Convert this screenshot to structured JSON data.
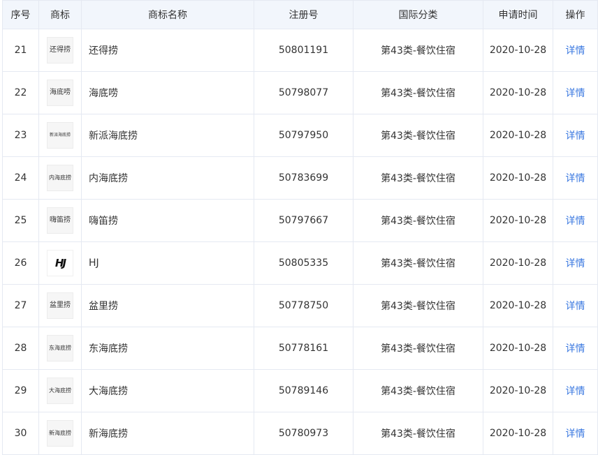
{
  "headers": {
    "index": "序号",
    "logo": "商标",
    "name": "商标名称",
    "reg_no": "注册号",
    "class": "国际分类",
    "date": "申请时间",
    "action": "操作"
  },
  "rows": [
    {
      "index": "21",
      "logo_text": "还得捞",
      "name": "还得捞",
      "reg_no": "50801191",
      "class": "第43类-餐饮住宿",
      "date": "2020-10-28",
      "action": "详情"
    },
    {
      "index": "22",
      "logo_text": "海底唠",
      "name": "海底唠",
      "reg_no": "50798077",
      "class": "第43类-餐饮住宿",
      "date": "2020-10-28",
      "action": "详情"
    },
    {
      "index": "23",
      "logo_text": "新派海底捞",
      "name": "新派海底捞",
      "reg_no": "50797950",
      "class": "第43类-餐饮住宿",
      "date": "2020-10-28",
      "action": "详情"
    },
    {
      "index": "24",
      "logo_text": "内海底捞",
      "name": "内海底捞",
      "reg_no": "50783699",
      "class": "第43类-餐饮住宿",
      "date": "2020-10-28",
      "action": "详情"
    },
    {
      "index": "25",
      "logo_text": "嗨笛捞",
      "name": "嗨笛捞",
      "reg_no": "50797667",
      "class": "第43类-餐饮住宿",
      "date": "2020-10-28",
      "action": "详情"
    },
    {
      "index": "26",
      "logo_text": "HJ",
      "name": "HJ",
      "reg_no": "50805335",
      "class": "第43类-餐饮住宿",
      "date": "2020-10-28",
      "action": "详情"
    },
    {
      "index": "27",
      "logo_text": "盆里捞",
      "name": "盆里捞",
      "reg_no": "50778750",
      "class": "第43类-餐饮住宿",
      "date": "2020-10-28",
      "action": "详情"
    },
    {
      "index": "28",
      "logo_text": "东海底捞",
      "name": "东海底捞",
      "reg_no": "50778161",
      "class": "第43类-餐饮住宿",
      "date": "2020-10-28",
      "action": "详情"
    },
    {
      "index": "29",
      "logo_text": "大海底捞",
      "name": "大海底捞",
      "reg_no": "50789146",
      "class": "第43类-餐饮住宿",
      "date": "2020-10-28",
      "action": "详情"
    },
    {
      "index": "30",
      "logo_text": "新海底捞",
      "name": "新海底捞",
      "reg_no": "50780973",
      "class": "第43类-餐饮住宿",
      "date": "2020-10-28",
      "action": "详情"
    }
  ],
  "colors": {
    "header_background": "#f2f6fc",
    "border": "#e5e9f2",
    "link": "#3a78e0",
    "text": "#333333"
  }
}
